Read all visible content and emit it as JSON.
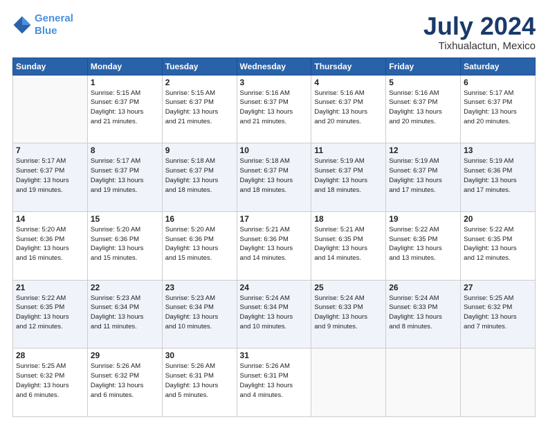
{
  "logo": {
    "line1": "General",
    "line2": "Blue"
  },
  "title": "July 2024",
  "subtitle": "Tixhualactun, Mexico",
  "headers": [
    "Sunday",
    "Monday",
    "Tuesday",
    "Wednesday",
    "Thursday",
    "Friday",
    "Saturday"
  ],
  "weeks": [
    [
      {
        "day": "",
        "info": ""
      },
      {
        "day": "1",
        "info": "Sunrise: 5:15 AM\nSunset: 6:37 PM\nDaylight: 13 hours\nand 21 minutes."
      },
      {
        "day": "2",
        "info": "Sunrise: 5:15 AM\nSunset: 6:37 PM\nDaylight: 13 hours\nand 21 minutes."
      },
      {
        "day": "3",
        "info": "Sunrise: 5:16 AM\nSunset: 6:37 PM\nDaylight: 13 hours\nand 21 minutes."
      },
      {
        "day": "4",
        "info": "Sunrise: 5:16 AM\nSunset: 6:37 PM\nDaylight: 13 hours\nand 20 minutes."
      },
      {
        "day": "5",
        "info": "Sunrise: 5:16 AM\nSunset: 6:37 PM\nDaylight: 13 hours\nand 20 minutes."
      },
      {
        "day": "6",
        "info": "Sunrise: 5:17 AM\nSunset: 6:37 PM\nDaylight: 13 hours\nand 20 minutes."
      }
    ],
    [
      {
        "day": "7",
        "info": "Sunrise: 5:17 AM\nSunset: 6:37 PM\nDaylight: 13 hours\nand 19 minutes."
      },
      {
        "day": "8",
        "info": "Sunrise: 5:17 AM\nSunset: 6:37 PM\nDaylight: 13 hours\nand 19 minutes."
      },
      {
        "day": "9",
        "info": "Sunrise: 5:18 AM\nSunset: 6:37 PM\nDaylight: 13 hours\nand 18 minutes."
      },
      {
        "day": "10",
        "info": "Sunrise: 5:18 AM\nSunset: 6:37 PM\nDaylight: 13 hours\nand 18 minutes."
      },
      {
        "day": "11",
        "info": "Sunrise: 5:19 AM\nSunset: 6:37 PM\nDaylight: 13 hours\nand 18 minutes."
      },
      {
        "day": "12",
        "info": "Sunrise: 5:19 AM\nSunset: 6:37 PM\nDaylight: 13 hours\nand 17 minutes."
      },
      {
        "day": "13",
        "info": "Sunrise: 5:19 AM\nSunset: 6:36 PM\nDaylight: 13 hours\nand 17 minutes."
      }
    ],
    [
      {
        "day": "14",
        "info": "Sunrise: 5:20 AM\nSunset: 6:36 PM\nDaylight: 13 hours\nand 16 minutes."
      },
      {
        "day": "15",
        "info": "Sunrise: 5:20 AM\nSunset: 6:36 PM\nDaylight: 13 hours\nand 15 minutes."
      },
      {
        "day": "16",
        "info": "Sunrise: 5:20 AM\nSunset: 6:36 PM\nDaylight: 13 hours\nand 15 minutes."
      },
      {
        "day": "17",
        "info": "Sunrise: 5:21 AM\nSunset: 6:36 PM\nDaylight: 13 hours\nand 14 minutes."
      },
      {
        "day": "18",
        "info": "Sunrise: 5:21 AM\nSunset: 6:35 PM\nDaylight: 13 hours\nand 14 minutes."
      },
      {
        "day": "19",
        "info": "Sunrise: 5:22 AM\nSunset: 6:35 PM\nDaylight: 13 hours\nand 13 minutes."
      },
      {
        "day": "20",
        "info": "Sunrise: 5:22 AM\nSunset: 6:35 PM\nDaylight: 13 hours\nand 12 minutes."
      }
    ],
    [
      {
        "day": "21",
        "info": "Sunrise: 5:22 AM\nSunset: 6:35 PM\nDaylight: 13 hours\nand 12 minutes."
      },
      {
        "day": "22",
        "info": "Sunrise: 5:23 AM\nSunset: 6:34 PM\nDaylight: 13 hours\nand 11 minutes."
      },
      {
        "day": "23",
        "info": "Sunrise: 5:23 AM\nSunset: 6:34 PM\nDaylight: 13 hours\nand 10 minutes."
      },
      {
        "day": "24",
        "info": "Sunrise: 5:24 AM\nSunset: 6:34 PM\nDaylight: 13 hours\nand 10 minutes."
      },
      {
        "day": "25",
        "info": "Sunrise: 5:24 AM\nSunset: 6:33 PM\nDaylight: 13 hours\nand 9 minutes."
      },
      {
        "day": "26",
        "info": "Sunrise: 5:24 AM\nSunset: 6:33 PM\nDaylight: 13 hours\nand 8 minutes."
      },
      {
        "day": "27",
        "info": "Sunrise: 5:25 AM\nSunset: 6:32 PM\nDaylight: 13 hours\nand 7 minutes."
      }
    ],
    [
      {
        "day": "28",
        "info": "Sunrise: 5:25 AM\nSunset: 6:32 PM\nDaylight: 13 hours\nand 6 minutes."
      },
      {
        "day": "29",
        "info": "Sunrise: 5:26 AM\nSunset: 6:32 PM\nDaylight: 13 hours\nand 6 minutes."
      },
      {
        "day": "30",
        "info": "Sunrise: 5:26 AM\nSunset: 6:31 PM\nDaylight: 13 hours\nand 5 minutes."
      },
      {
        "day": "31",
        "info": "Sunrise: 5:26 AM\nSunset: 6:31 PM\nDaylight: 13 hours\nand 4 minutes."
      },
      {
        "day": "",
        "info": ""
      },
      {
        "day": "",
        "info": ""
      },
      {
        "day": "",
        "info": ""
      }
    ]
  ]
}
